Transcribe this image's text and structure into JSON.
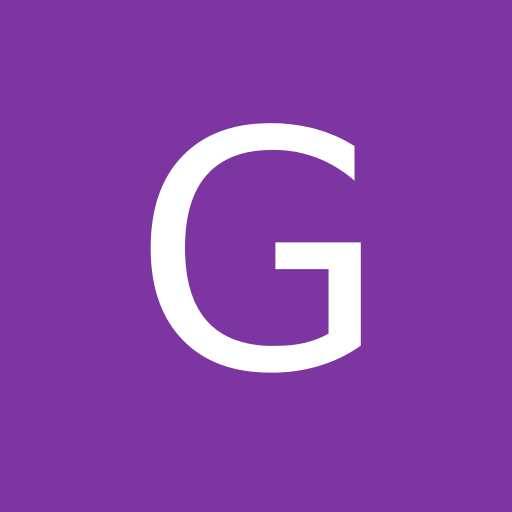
{
  "avatar": {
    "letter": "G",
    "background_color": "#7c35a1",
    "letter_color": "#ffffff"
  }
}
